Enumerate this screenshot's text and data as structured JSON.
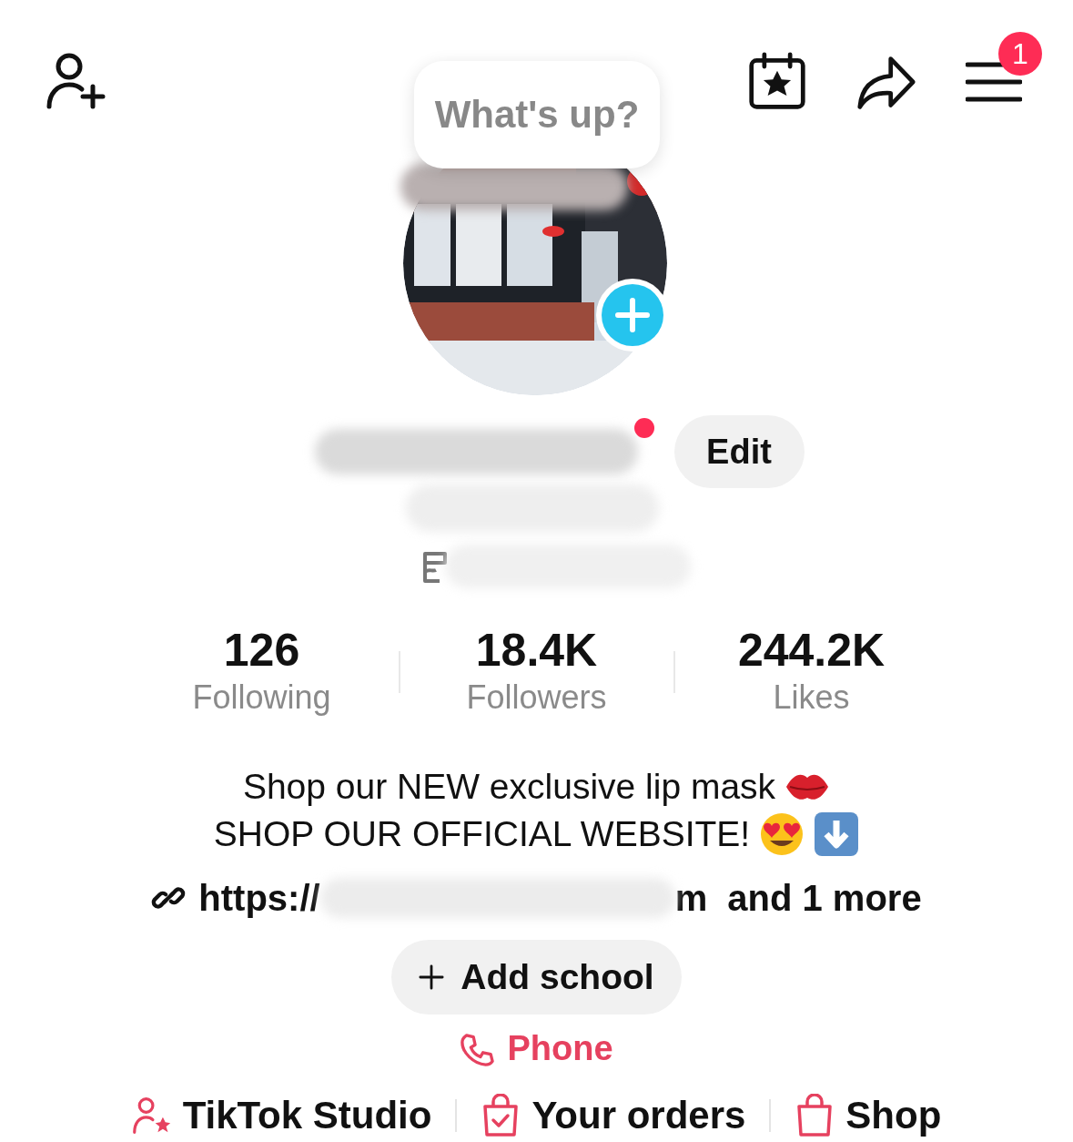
{
  "header": {
    "menu_badge": "1"
  },
  "bubble": {
    "text": "What's up?"
  },
  "edit_button": {
    "label": "Edit"
  },
  "stats": [
    {
      "value": "126",
      "label": "Following"
    },
    {
      "value": "18.4K",
      "label": "Followers"
    },
    {
      "value": "244.2K",
      "label": "Likes"
    }
  ],
  "bio": [
    "Shop our NEW exclusive lip mask",
    "SHOP OUR OFFICIAL WEBSITE!"
  ],
  "link": {
    "prefix": "https://",
    "suffix": "m",
    "more": "and 1 more"
  },
  "add_school": {
    "label": "Add school"
  },
  "phone": {
    "label": "Phone"
  },
  "shortcuts": [
    {
      "kind": "studio",
      "label": "TikTok Studio"
    },
    {
      "kind": "orders",
      "label": "Your orders"
    },
    {
      "kind": "shop",
      "label": "Shop"
    }
  ]
}
